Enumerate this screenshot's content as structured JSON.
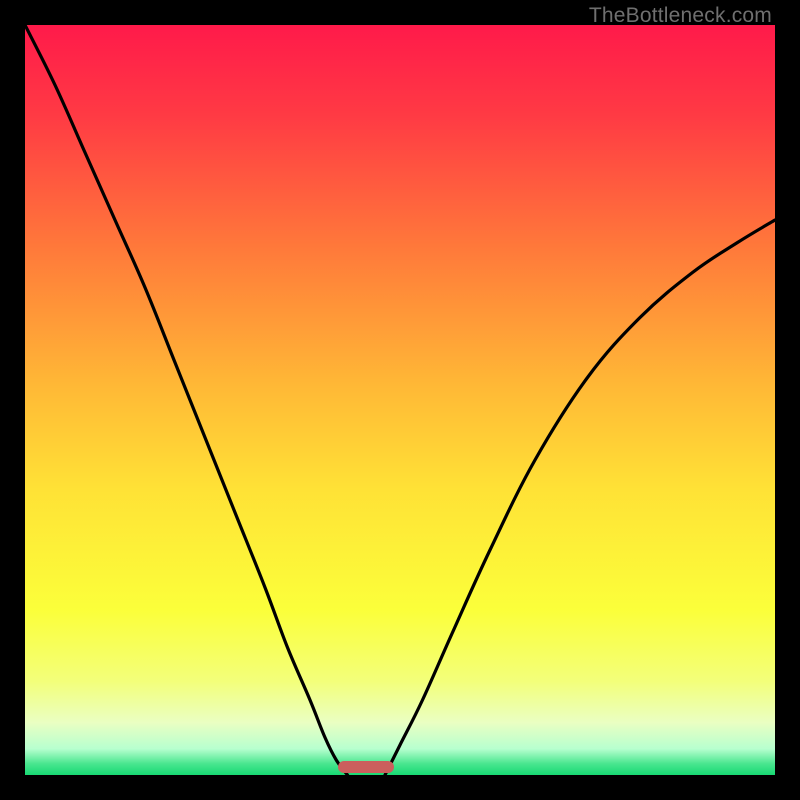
{
  "watermark": "TheBottleneck.com",
  "colors": {
    "frame": "#000000",
    "marker": "#cb5f5d",
    "curve": "#000000",
    "gradient_stops": [
      {
        "pos": 0.0,
        "color": "#ff1a4a"
      },
      {
        "pos": 0.12,
        "color": "#ff3a44"
      },
      {
        "pos": 0.3,
        "color": "#ff7a3a"
      },
      {
        "pos": 0.48,
        "color": "#ffb836"
      },
      {
        "pos": 0.62,
        "color": "#ffe236"
      },
      {
        "pos": 0.78,
        "color": "#fbff3a"
      },
      {
        "pos": 0.875,
        "color": "#f3ff7a"
      },
      {
        "pos": 0.93,
        "color": "#eaffc2"
      },
      {
        "pos": 0.965,
        "color": "#b7ffcf"
      },
      {
        "pos": 0.985,
        "color": "#49e68f"
      },
      {
        "pos": 1.0,
        "color": "#18d973"
      }
    ]
  },
  "chart_data": {
    "type": "line",
    "title": "",
    "xlabel": "",
    "ylabel": "",
    "xlim": [
      0,
      100
    ],
    "ylim": [
      0,
      100
    ],
    "grid": false,
    "legend": false,
    "note": "x is horizontal position (% of plot width, 0=left). y is vertical position (% of plot height, 0=bottom). Two branches of an abs-like curve meeting near the bottom; a short salmon bar marks the minimum.",
    "series": [
      {
        "name": "left-branch",
        "x": [
          0,
          4,
          8,
          12,
          16,
          20,
          24,
          28,
          32,
          35,
          38,
          40,
          41.5,
          43
        ],
        "y": [
          100,
          92,
          83,
          74,
          65,
          55,
          45,
          35,
          25,
          17,
          10,
          5,
          2,
          0
        ]
      },
      {
        "name": "right-branch",
        "x": [
          48,
          50,
          53,
          57,
          62,
          68,
          75,
          82,
          89,
          95,
          100
        ],
        "y": [
          0,
          4,
          10,
          19,
          30,
          42,
          53,
          61,
          67,
          71,
          74
        ]
      }
    ],
    "marker": {
      "shape": "rounded-bar",
      "x_center": 45.5,
      "width_pct": 7.5,
      "y_bottom": 0.3,
      "height_pct": 1.6
    }
  }
}
